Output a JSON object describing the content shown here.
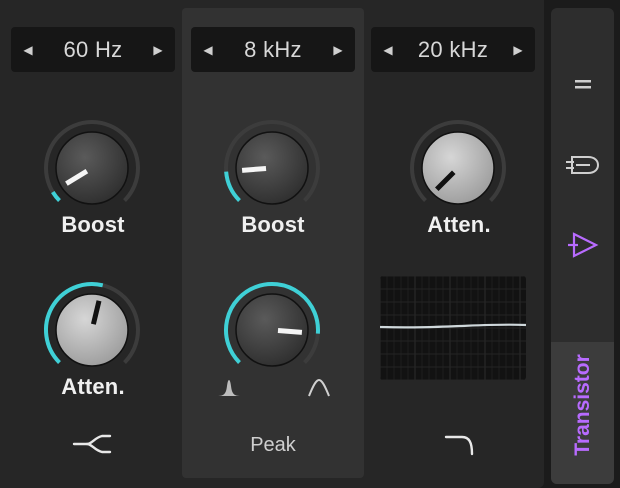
{
  "bands": [
    {
      "frequency": "60 Hz",
      "knob1_label": "Boost",
      "knob2_label": "Atten.",
      "boost_level": 0.05,
      "atten_level": 0.55
    },
    {
      "frequency": "8 kHz",
      "knob1_label": "Boost",
      "knob2_label": "",
      "bottom_label": "Peak",
      "boost_level": 0.15,
      "q_level": 0.85
    },
    {
      "frequency": "20 kHz",
      "knob1_label": "Atten.",
      "atten_level": 0.0
    }
  ],
  "sidebar": {
    "tab_label": "Transistor",
    "icons": [
      "equals-icon",
      "transistor-icon",
      "triangle-play-icon"
    ]
  },
  "colors": {
    "accent": "#3fd0d6",
    "purple": "#b86bff",
    "panel": "#262626",
    "knob_body": "#3a3a3a"
  },
  "icons": {
    "band1_shape": "lowshelf-crossover-icon",
    "band2_left": "narrow-peak-icon",
    "band2_right": "wide-peak-icon",
    "band3_shape": "highcut-curve-icon"
  }
}
